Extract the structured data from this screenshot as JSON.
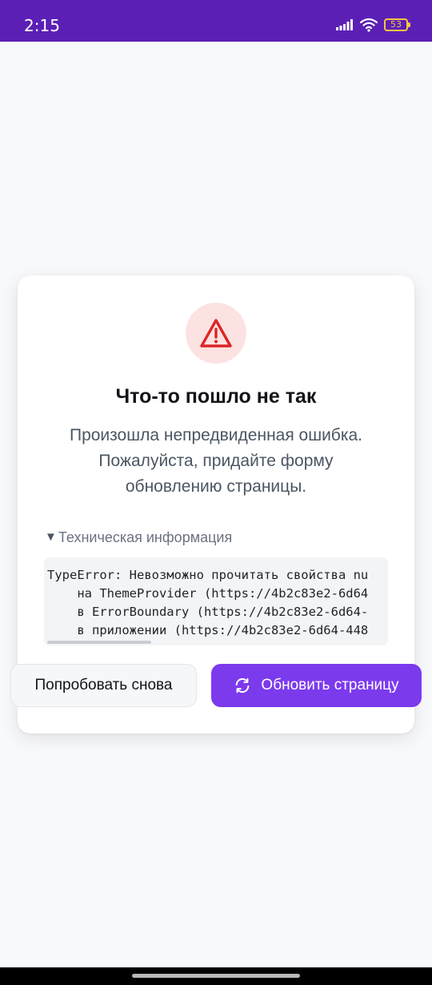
{
  "status_bar": {
    "time": "2:15",
    "battery_level": "53",
    "background_color": "#5b1fb5"
  },
  "error_card": {
    "icon": "warning-triangle-icon",
    "title": "Что-то пошло не так",
    "message_lines": [
      "Произошла непредвиденная ошибка.",
      "Пожалуйста, придайте форму",
      "обновлению страницы."
    ],
    "details": {
      "summary_marker": "▼",
      "summary": "Техническая информация",
      "expanded": true,
      "stack_lines": [
        "TypeError: Невозможно прочитать свойства nu",
        "    на ThemeProvider (https://4b2c83e2-6d64",
        "    в ErrorBoundary (https://4b2c83e2-6d64-",
        "    в приложении (https://4b2c83e2-6d64-448"
      ]
    },
    "buttons": {
      "retry_label": "Попробовать снова",
      "reload_label": "Обновить страницу",
      "reload_icon": "refresh-icon"
    }
  },
  "colors": {
    "accent": "#7c3aed",
    "error": "#dc2626",
    "error_bg": "#fde2e2"
  }
}
